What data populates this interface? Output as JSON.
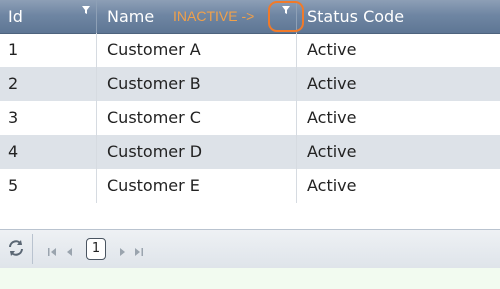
{
  "columns": [
    {
      "label": "Id",
      "filter_icon": "filter-icon"
    },
    {
      "label": "Name",
      "filter_icon": "filter-icon"
    },
    {
      "label": "Status Code"
    }
  ],
  "annotation": {
    "text": "INACTIVE ->",
    "color": "#f0a04a",
    "ring_color": "#f07a2a"
  },
  "rows": [
    {
      "id": "1",
      "name": "Customer A",
      "status": "Active"
    },
    {
      "id": "2",
      "name": "Customer B",
      "status": "Active"
    },
    {
      "id": "3",
      "name": "Customer C",
      "status": "Active"
    },
    {
      "id": "4",
      "name": "Customer D",
      "status": "Active"
    },
    {
      "id": "5",
      "name": "Customer E",
      "status": "Active"
    }
  ],
  "pager": {
    "current_page": "1",
    "icons": [
      "refresh-icon",
      "first-page-icon",
      "prev-page-icon",
      "next-page-icon",
      "last-page-icon"
    ]
  },
  "colors": {
    "header": "#6f86a3",
    "alt_row": "#dde2e8"
  }
}
